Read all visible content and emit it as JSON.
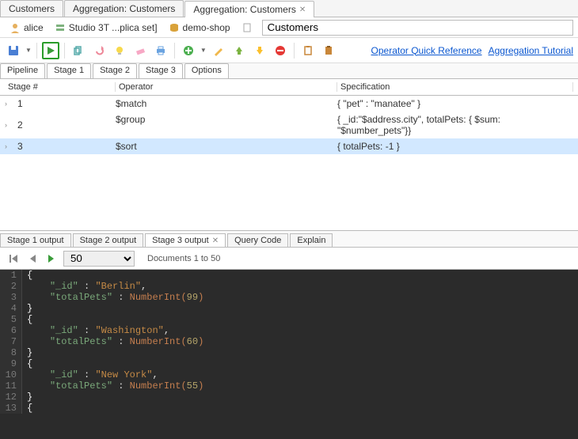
{
  "topTabs": [
    {
      "label": "Customers",
      "active": false
    },
    {
      "label": "Aggregation: Customers",
      "active": false
    },
    {
      "label": "Aggregation: Customers",
      "active": true,
      "closable": true
    }
  ],
  "breadcrumb": {
    "user": "alice",
    "server": "Studio 3T ...plica set]",
    "database": "demo-shop",
    "collection": "Customers"
  },
  "links": {
    "quickRef": "Operator Quick Reference",
    "tutorial": "Aggregation Tutorial"
  },
  "subtabs": [
    "Pipeline",
    "Stage 1",
    "Stage 2",
    "Stage 3",
    "Options"
  ],
  "subtabActive": 0,
  "pipelineHeaders": {
    "stage": "Stage #",
    "operator": "Operator",
    "spec": "Specification"
  },
  "pipeline": [
    {
      "n": "1",
      "operator": "$match",
      "spec": "{ \"pet\" : \"manatee\" }",
      "selected": false
    },
    {
      "n": "2",
      "operator": "$group",
      "spec": "{ _id:\"$address.city\", totalPets: { $sum: \"$number_pets\"}}",
      "selected": false
    },
    {
      "n": "3",
      "operator": "$sort",
      "spec": "{ totalPets: -1 }",
      "selected": true
    }
  ],
  "outputTabs": [
    {
      "label": "Stage 1 output",
      "active": false
    },
    {
      "label": "Stage 2 output",
      "active": false
    },
    {
      "label": "Stage 3 output",
      "active": true,
      "closable": true
    },
    {
      "label": "Query Code",
      "active": false
    },
    {
      "label": "Explain",
      "active": false
    }
  ],
  "pager": {
    "pageSize": "50",
    "rangeText": "Documents 1 to 50"
  },
  "results": [
    {
      "city": "Berlin",
      "total": 99
    },
    {
      "city": "Washington",
      "total": 60
    },
    {
      "city": "New York",
      "total": 55
    }
  ],
  "resultKeys": {
    "id": "\"_id\"",
    "total": "\"totalPets\"",
    "fn": "NumberInt"
  }
}
